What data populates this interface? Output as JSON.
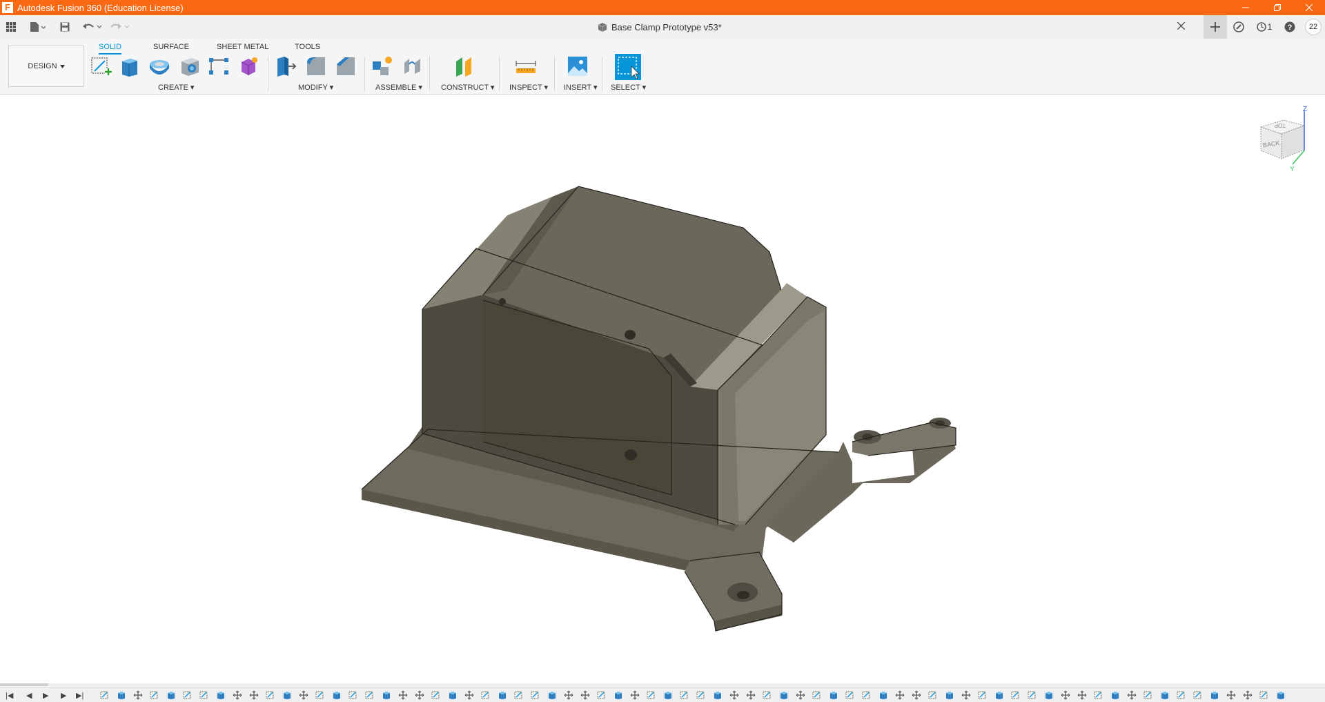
{
  "titlebar": {
    "title": "Autodesk Fusion 360 (Education License)",
    "logo": "F"
  },
  "document": {
    "title": "Base Clamp Prototype v53*"
  },
  "quick_access": {
    "jobs_count": "1",
    "user_initials": "22"
  },
  "ribbon": {
    "workspace": "DESIGN",
    "tabs": [
      "SOLID",
      "SURFACE",
      "SHEET METAL",
      "TOOLS"
    ],
    "groups": {
      "create": "CREATE",
      "modify": "MODIFY",
      "assemble": "ASSEMBLE",
      "construct": "CONSTRUCT",
      "inspect": "INSPECT",
      "insert": "INSERT",
      "select": "SELECT"
    }
  },
  "viewcube": {
    "face_top": "TOP",
    "face_back": "BACK",
    "axis_z": "Z",
    "axis_y": "Y"
  },
  "colors": {
    "titlebar": "#f96812",
    "accent": "#0696d7",
    "model": "#6e6a5d"
  }
}
